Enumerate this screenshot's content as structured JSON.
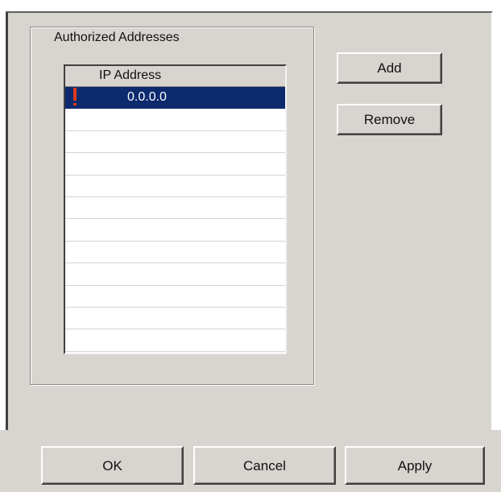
{
  "group": {
    "title": "Authorized Addresses"
  },
  "list": {
    "columns": [
      "IP Address"
    ],
    "rows": [
      {
        "ip": "0.0.0.0",
        "selected": true,
        "flag": "warning-exclamation-icon"
      },
      {
        "ip": ""
      },
      {
        "ip": ""
      },
      {
        "ip": ""
      },
      {
        "ip": ""
      },
      {
        "ip": ""
      },
      {
        "ip": ""
      },
      {
        "ip": ""
      },
      {
        "ip": ""
      },
      {
        "ip": ""
      },
      {
        "ip": ""
      },
      {
        "ip": ""
      }
    ]
  },
  "buttons": {
    "add": "Add",
    "remove": "Remove",
    "ok": "OK",
    "cancel": "Cancel",
    "apply": "Apply"
  },
  "colors": {
    "panel": "#d8d4cf",
    "selection": "#0d2a6e",
    "flag": "#e03a1a"
  }
}
